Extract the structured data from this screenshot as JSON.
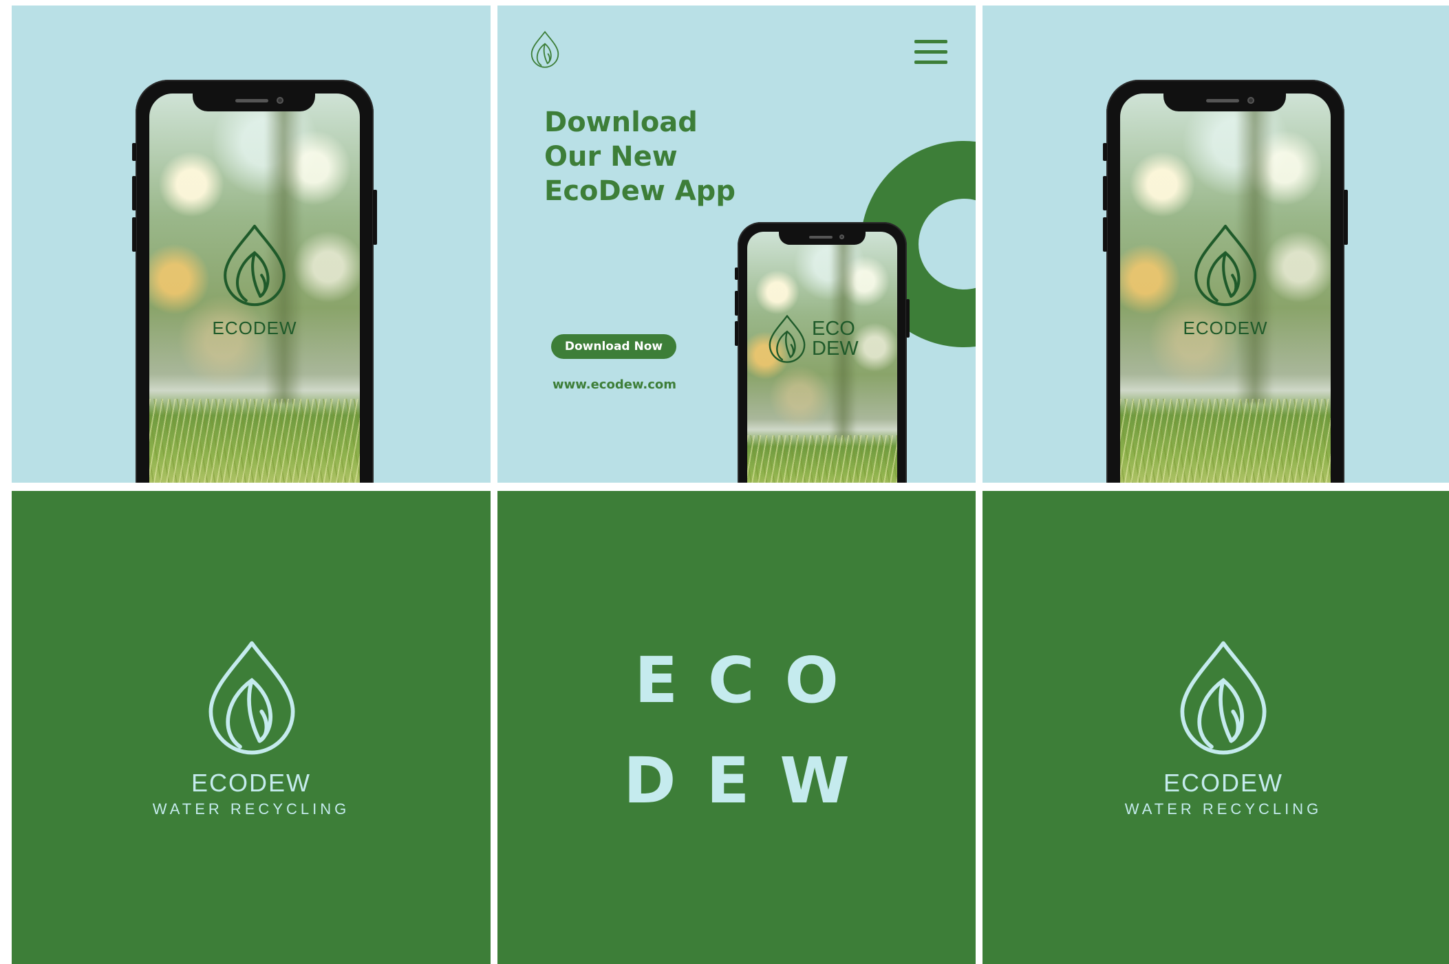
{
  "colors": {
    "light_bg": "#b9e0e6",
    "brand_green": "#3d7e38",
    "dark_green": "#1f5a2a",
    "light_text": "#c5ebee",
    "grid_gap": "#ffffff"
  },
  "icons": [
    "leaf-drop-icon",
    "hamburger-menu-icon"
  ],
  "tile1": {
    "screen_brand": "ECODEW"
  },
  "tile2": {
    "headline": [
      "Download",
      "Our New",
      "EcoDew App"
    ],
    "cta_label": "Download Now",
    "url": "www.ecodew.com",
    "screen_brand_line1": "ECO",
    "screen_brand_line2": "DEW"
  },
  "tile3": {
    "screen_brand": "ECODEW"
  },
  "tile4": {
    "brand": "ECODEW",
    "tagline": "WATER RECYCLING"
  },
  "tile5": {
    "line1": "ECO",
    "line2": "DEW"
  },
  "tile6": {
    "brand": "ECODEW",
    "tagline": "WATER RECYCLING"
  }
}
